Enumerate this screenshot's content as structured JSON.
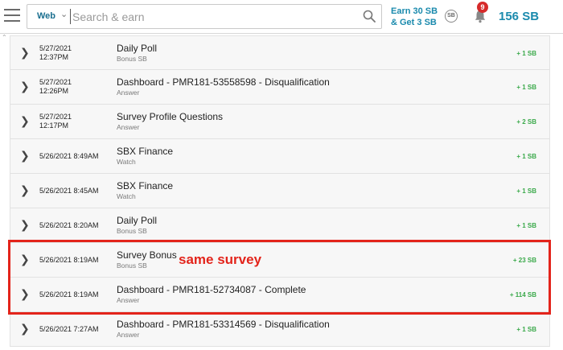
{
  "header": {
    "search_scope": "Web",
    "search_placeholder": "Search & earn",
    "earn_line1": "Earn 30 SB",
    "earn_line2": "& Get 3 SB",
    "coin_label": "SB",
    "notification_count": "9",
    "balance": "156 SB"
  },
  "activity": [
    {
      "date": "5/27/2021",
      "time": "12:37PM",
      "title": "Daily Poll",
      "type": "Bonus SB",
      "points": "+ 1 SB"
    },
    {
      "date": "5/27/2021",
      "time": "12:26PM",
      "title": "Dashboard - PMR181-53558598 - Disqualification",
      "type": "Answer",
      "points": "+ 1 SB"
    },
    {
      "date": "5/27/2021",
      "time": "12:17PM",
      "title": "Survey Profile Questions",
      "type": "Answer",
      "points": "+ 2 SB"
    },
    {
      "date": "5/26/2021 8:49AM",
      "time": "",
      "title": "SBX Finance",
      "type": "Watch",
      "points": "+ 1 SB"
    },
    {
      "date": "5/26/2021 8:45AM",
      "time": "",
      "title": "SBX Finance",
      "type": "Watch",
      "points": "+ 1 SB"
    },
    {
      "date": "5/26/2021 8:20AM",
      "time": "",
      "title": "Daily Poll",
      "type": "Bonus SB",
      "points": "+ 1 SB"
    },
    {
      "date": "5/26/2021 8:19AM",
      "time": "",
      "title": "Survey Bonus",
      "type": "Bonus SB",
      "points": "+ 23 SB"
    },
    {
      "date": "5/26/2021 8:19AM",
      "time": "",
      "title": "Dashboard - PMR181-52734087 - Complete",
      "type": "Answer",
      "points": "+ 114 SB"
    },
    {
      "date": "5/26/2021 7:27AM",
      "time": "",
      "title": "Dashboard - PMR181-53314569 - Disqualification",
      "type": "Answer",
      "points": "+ 1 SB"
    }
  ],
  "annotation": "same survey",
  "colors": {
    "brand": "#1a8aad",
    "points": "#3aa94a",
    "annotation": "#e3241b",
    "badge": "#d62a2a"
  }
}
